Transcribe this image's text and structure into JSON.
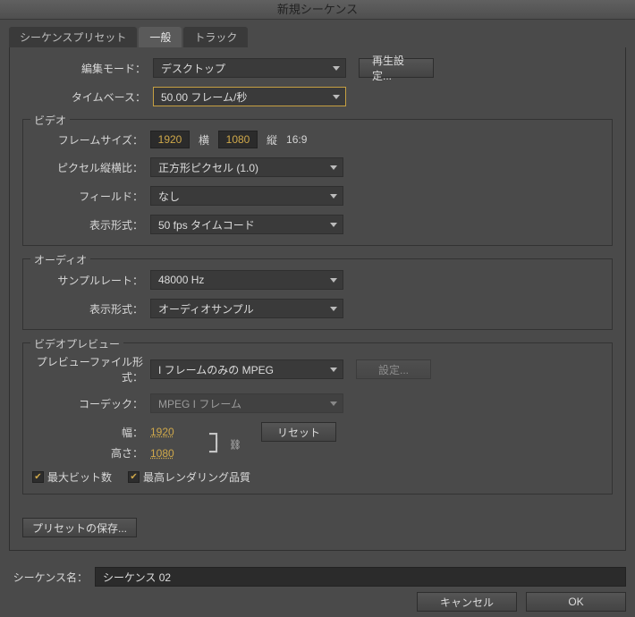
{
  "window": {
    "title": "新規シーケンス"
  },
  "tabs": {
    "presets": "シーケンスプリセット",
    "general": "一般",
    "tracks": "トラック"
  },
  "labels": {
    "editMode": "編集モード：",
    "timebase": "タイムベース：",
    "frameSize": "フレームサイズ：",
    "pixelAspect": "ピクセル縦横比：",
    "fields": "フィールド：",
    "displayFormatV": "表示形式：",
    "sampleRate": "サンプルレート：",
    "displayFormatA": "表示形式：",
    "previewFileFormat": "プレビューファイル形式：",
    "codec": "コーデック：",
    "width": "幅：",
    "height": "高さ：",
    "sequenceName": "シーケンス名："
  },
  "groups": {
    "video": "ビデオ",
    "audio": "オーディオ",
    "preview": "ビデオプレビュー"
  },
  "values": {
    "editMode": "デスクトップ",
    "timebase": "50.00 フレーム/秒",
    "frameW": "1920",
    "frameH": "1080",
    "horiz": "横",
    "vert": "縦",
    "aspectText": "16:9",
    "pixelAspect": "正方形ピクセル (1.0)",
    "fields": "なし",
    "displayFormatV": "50 fps タイムコード",
    "sampleRate": "48000 Hz",
    "displayFormatA": "オーディオサンプル",
    "previewFileFormat": "I フレームのみの MPEG",
    "codec": "MPEG I フレーム",
    "previewW": "1920",
    "previewH": "1080",
    "sequenceName": "シーケンス 02"
  },
  "buttons": {
    "playbackSettings": "再生設定...",
    "settings": "設定...",
    "reset": "リセット",
    "savePreset": "プリセットの保存...",
    "cancel": "キャンセル",
    "ok": "OK"
  },
  "checkboxes": {
    "maxBitDepth": "最大ビット数",
    "maxRenderQuality": "最高レンダリング品質"
  }
}
